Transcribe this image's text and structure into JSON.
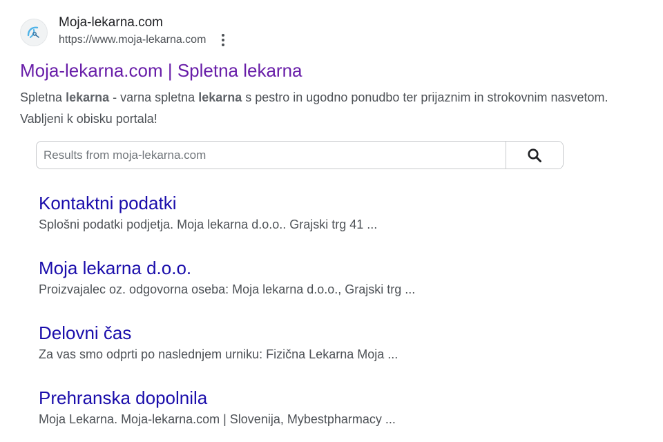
{
  "site": {
    "name": "Moja-lekarna.com",
    "url": "https://www.moja-lekarna.com",
    "favicon": "moja-lekarna-logo"
  },
  "result": {
    "title": "Moja-lekarna.com | Spletna lekarna",
    "snippet_parts": [
      {
        "text": "Spletna ",
        "bold": false
      },
      {
        "text": "lekarna",
        "bold": true
      },
      {
        "text": " - varna spletna ",
        "bold": false
      },
      {
        "text": "lekarna",
        "bold": true
      },
      {
        "text": " s pestro in ugodno ponudbo ter prijaznim in strokovnim nasvetom. Vabljeni k obisku portala!",
        "bold": false
      }
    ]
  },
  "site_search": {
    "placeholder": "Results from moja-lekarna.com",
    "button_icon": "search-icon"
  },
  "sitelinks": [
    {
      "title": "Kontaktni podatki",
      "description": "Splošni podatki podjetja. Moja lekarna d.o.o.. Grajski trg 41 ..."
    },
    {
      "title": "Moja lekarna d.o.o.",
      "description": "Proizvajalec oz. odgovorna oseba: Moja lekarna d.o.o., Grajski trg ..."
    },
    {
      "title": "Delovni čas",
      "description": "Za vas smo odprti po naslednjem urniku: Fizična Lekarna Moja ..."
    },
    {
      "title": "Prehranska dopolnila",
      "description": "Moja Lekarna. Moja-lekarna.com | Slovenija, Mybestpharmacy ..."
    }
  ],
  "colors": {
    "visited_link": "#681da8",
    "link": "#1a0dab",
    "snippet_text": "#4d5156",
    "favicon_accent": "#4fb3e8"
  }
}
